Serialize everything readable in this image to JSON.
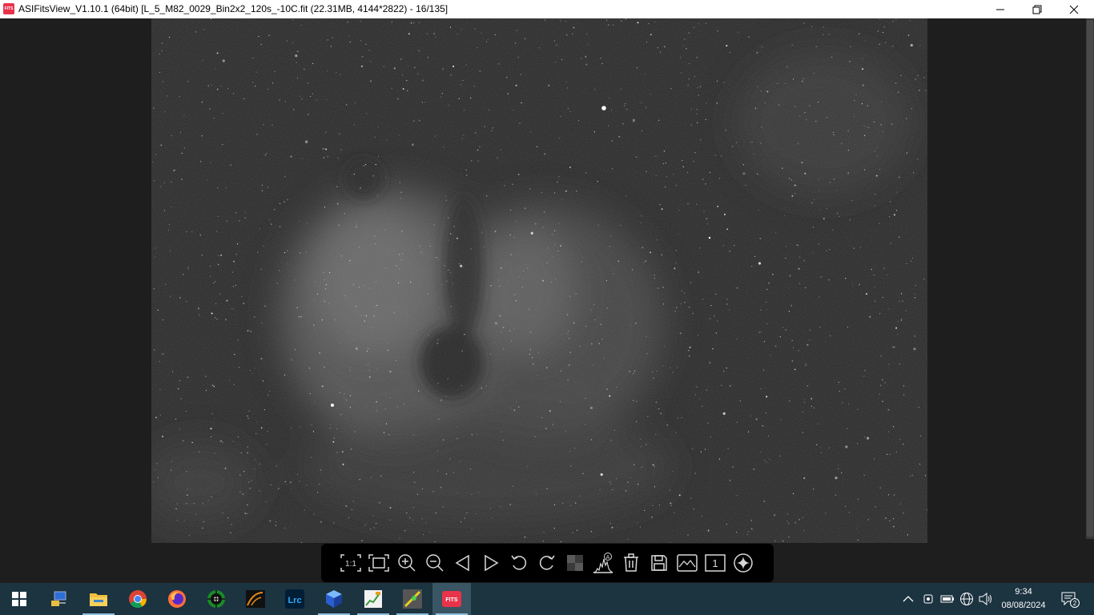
{
  "window": {
    "title": "ASIFitsView_V1.10.1 (64bit) [L_5_M82_0029_Bin2x2_120s_-10C.fit (22.31MB, 4144*2822) - 16/135]",
    "app_icon_text": "FITS"
  },
  "toolbar": {
    "buttons": [
      {
        "name": "actual-size",
        "label": "1:1"
      },
      {
        "name": "fit-window"
      },
      {
        "name": "zoom-in"
      },
      {
        "name": "zoom-out"
      },
      {
        "name": "previous"
      },
      {
        "name": "next"
      },
      {
        "name": "rotate-left"
      },
      {
        "name": "rotate-right"
      },
      {
        "name": "debayer"
      },
      {
        "name": "auto-stretch-histogram",
        "label": "A"
      },
      {
        "name": "delete"
      },
      {
        "name": "save"
      },
      {
        "name": "image-info"
      },
      {
        "name": "single-view",
        "label": "1"
      },
      {
        "name": "star-detect"
      }
    ]
  },
  "taskbar": {
    "apps": [
      "start",
      "network-tool",
      "file-explorer",
      "chrome",
      "firefox",
      "phd2",
      "sharpcap",
      "lightroom-classic",
      "3d-app",
      "image-viewer",
      "photo-app",
      "asifitsview"
    ],
    "fits_label": "FITS",
    "lrc_label": "Lrc"
  },
  "tray": {
    "time": "9:34",
    "date": "08/08/2024",
    "notification_count": "2"
  },
  "colors": {
    "taskbar_bg": "#1c3340",
    "accent_red": "#e8334a"
  }
}
